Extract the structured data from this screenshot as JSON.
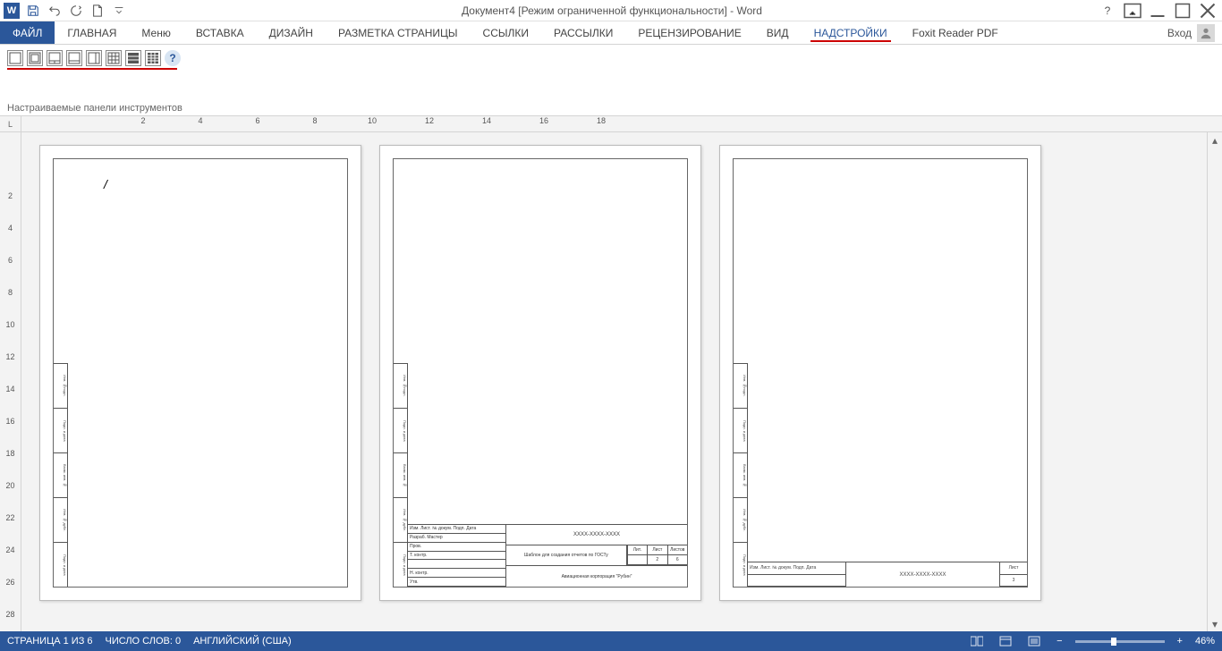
{
  "title": "Документ4 [Режим ограниченной функциональности] - Word",
  "signin": "Вход",
  "tabs": {
    "file": "ФАЙЛ",
    "home": "ГЛАВНАЯ",
    "menu": "Меню",
    "insert": "ВСТАВКА",
    "design": "ДИЗАЙН",
    "layout": "РАЗМЕТКА СТРАНИЦЫ",
    "references": "ССЫЛКИ",
    "mailings": "РАССЫЛКИ",
    "review": "РЕЦЕНЗИРОВАНИЕ",
    "view": "ВИД",
    "addins": "НАДСТРОЙКИ",
    "foxit": "Foxit Reader PDF"
  },
  "ribbon_group": "Настраиваемые панели инструментов",
  "ruler_h": [
    "2",
    "",
    "4",
    "",
    "6",
    "",
    "8",
    "",
    "10",
    "",
    "12",
    "",
    "14",
    "",
    "16",
    "",
    "18"
  ],
  "ruler_v": [
    "",
    "",
    "2",
    "",
    "4",
    "",
    "6",
    "",
    "8",
    "",
    "10",
    "",
    "12",
    "",
    "14",
    "",
    "16",
    "",
    "18",
    "",
    "20",
    "",
    "22",
    "",
    "24",
    "",
    "26",
    "",
    "28"
  ],
  "stamp": {
    "code": "ХХХХ-ХХХХ-ХХХХ",
    "template_title": "Шаблон для создания отчетов по ГОСТу",
    "company": "Авиационная корпорация \"Рубин\"",
    "col_lit": "Лит.",
    "col_list": "Лист",
    "col_listov": "Листов",
    "val_list": "2",
    "val_listov": "6",
    "val_list3": "3",
    "row_labels": [
      "Изм.  Лист.  № докум.  Подп.  Дата",
      "Разраб.   Мастер",
      "Пров.",
      "Т. контр.",
      "Н. контр.",
      "Утв."
    ],
    "side_labels": [
      "Инв. №подл.",
      "Подп. и дата",
      "Взам. инв. №",
      "Инв. № дубл.",
      "Подп. и дата"
    ]
  },
  "status": {
    "page": "СТРАНИЦА 1 ИЗ 6",
    "words": "ЧИСЛО СЛОВ: 0",
    "lang": "АНГЛИЙСКИЙ (США)",
    "zoom": "46%"
  }
}
